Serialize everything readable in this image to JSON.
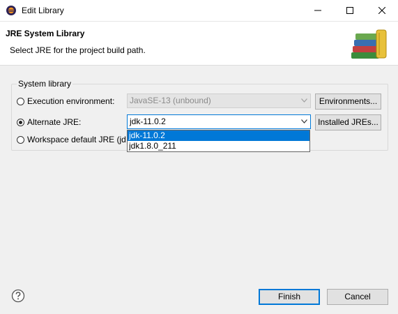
{
  "window": {
    "title": "Edit Library",
    "app_icon": "eclipse-icon",
    "controls": [
      "minimize-icon",
      "maximize-icon",
      "close-icon"
    ]
  },
  "banner": {
    "title": "JRE System Library",
    "message": "Select JRE for the project build path.",
    "image": "library-books-icon"
  },
  "group": {
    "label": "System library"
  },
  "options": {
    "execution_env": {
      "label": "Execution environment:",
      "value": "JavaSE-13 (unbound)",
      "checked": false,
      "button": "Environments..."
    },
    "alternate_jre": {
      "label": "Alternate JRE:",
      "value": "jdk-11.0.2",
      "checked": true,
      "button": "Installed JREs..."
    },
    "workspace_default": {
      "label": "Workspace default JRE (jd",
      "checked": false
    }
  },
  "dropdown": {
    "items": [
      "jdk-11.0.2",
      "jdk1.8.0_211"
    ],
    "selected_index": 0
  },
  "footer": {
    "help_icon": "help-icon",
    "finish": "Finish",
    "cancel": "Cancel"
  },
  "colors": {
    "accent": "#0078d7",
    "dialog_bg": "#f0f0f0"
  }
}
